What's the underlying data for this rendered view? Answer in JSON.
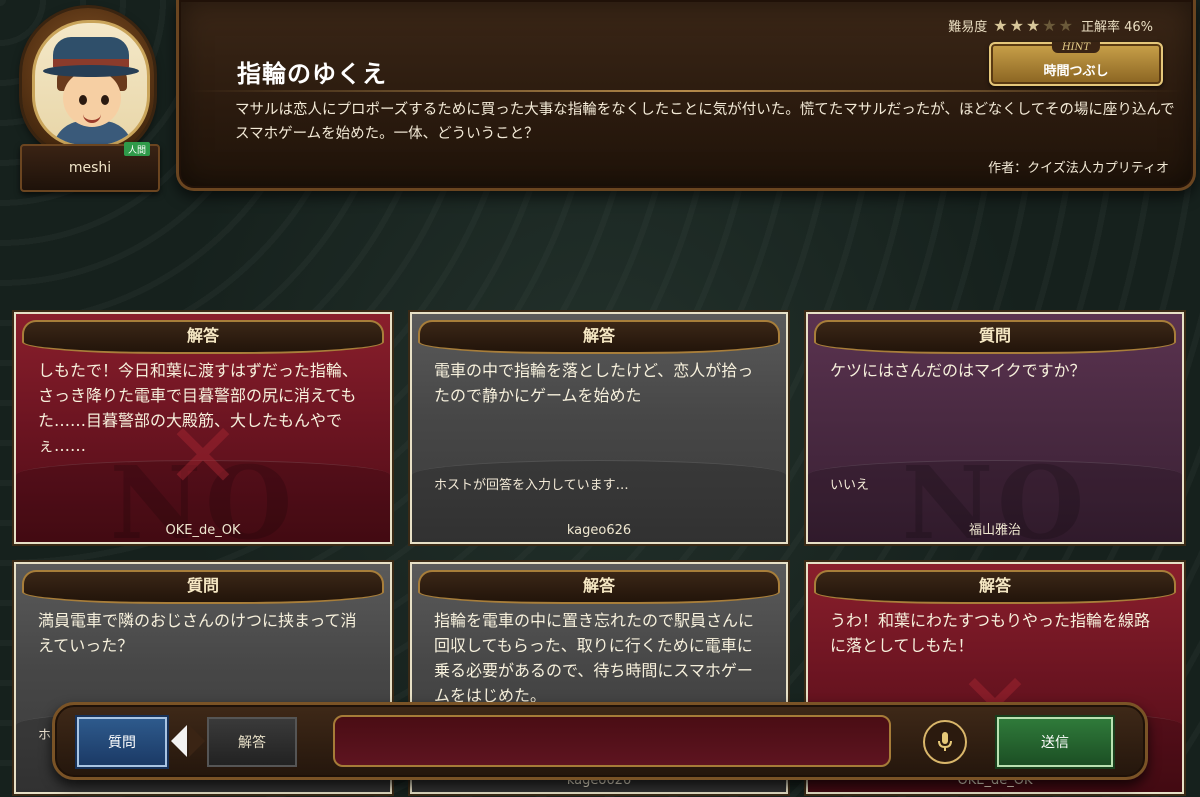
{
  "player": {
    "name": "meshi",
    "badge": "人間"
  },
  "question": {
    "title": "指輪のゆくえ",
    "text": "マサルは恋人にプロポーズするために買った大事な指輪をなくしたことに気が付いた。慌てたマサルだったが、ほどなくしてその場に座り込んでスマホゲームを始めた。一体、どういうこと？",
    "author": "作者：クイズ法人カプリティオ",
    "difficulty_label": "難易度",
    "difficulty_stars": 3,
    "difficulty_max": 5,
    "correct_rate": "正解率 46%",
    "hint_tag": "HINT",
    "hint_label": "時間つぶし"
  },
  "cards": [
    {
      "type": "解答",
      "color": "red",
      "text": "しもたで！今日和葉に渡すはずだった指輪、さっき降りた電車で目暮警部の尻に消えてもた……目暮警部の大殿筋、大したもんやでぇ……",
      "answer": "",
      "watermark": "NO",
      "x_mark": "✕",
      "user": "OKE_de_OK"
    },
    {
      "type": "解答",
      "color": "gray",
      "text": "電車の中で指輪を落としたけど、恋人が拾ったので静かにゲームを始めた",
      "answer": "ホストが回答を入力しています…",
      "watermark": "",
      "x_mark": "",
      "user": "kageo626"
    },
    {
      "type": "質問",
      "color": "purple",
      "text": "ケツにはさんだのはマイクですか？",
      "answer": "いいえ",
      "watermark": "NO",
      "x_mark": "",
      "user": "福山雅治"
    },
    {
      "type": "質問",
      "color": "gray",
      "text": "満員電車で隣のおじさんのけつに挟まって消えていった？",
      "answer": "ホ",
      "watermark": "",
      "x_mark": "",
      "user": ""
    },
    {
      "type": "解答",
      "color": "gray",
      "text": "指輪を電車の中に置き忘れたので駅員さんに回収してもらった、取りに行くために電車に乗る必要があるので、待ち時間にスマホゲームをはじめた。",
      "answer": "",
      "watermark": "",
      "x_mark": "",
      "user": "kageo626"
    },
    {
      "type": "解答",
      "color": "red",
      "text": "うわ！和葉にわたすつもりやった指輪を線路に落としてしもた！",
      "answer": "",
      "watermark": "",
      "x_mark": "✕",
      "user": "OKE_de_OK"
    }
  ],
  "input": {
    "question_button": "質問",
    "answer_button": "解答",
    "placeholder": "",
    "send_button": "送信"
  },
  "colors": {
    "red": "#6e1522",
    "gray": "#474747",
    "purple": "#4a2a42",
    "gold": "#a87e3a"
  }
}
